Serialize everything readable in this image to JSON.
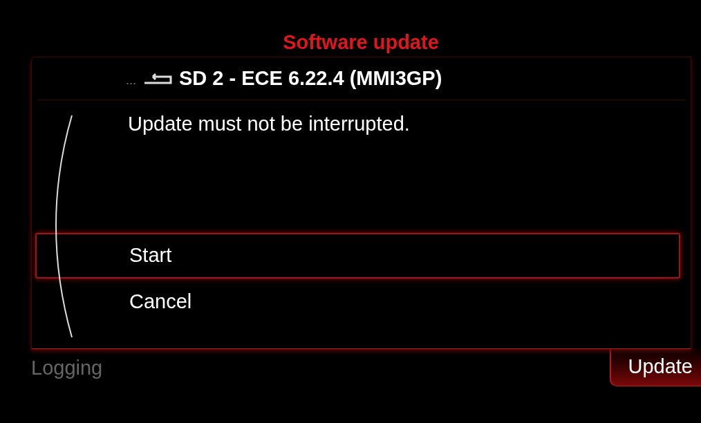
{
  "title": "Software update",
  "breadcrumb": {
    "prefix": "...",
    "label": "SD 2 - ECE 6.22.4 (MMI3GP)"
  },
  "message": "Update must not be interrupted.",
  "options": [
    {
      "label": "Start",
      "selected": true
    },
    {
      "label": "Cancel",
      "selected": false
    }
  ],
  "tabs": [
    {
      "label": "Logging",
      "selected": false
    },
    {
      "label": "Update",
      "selected": true
    }
  ]
}
